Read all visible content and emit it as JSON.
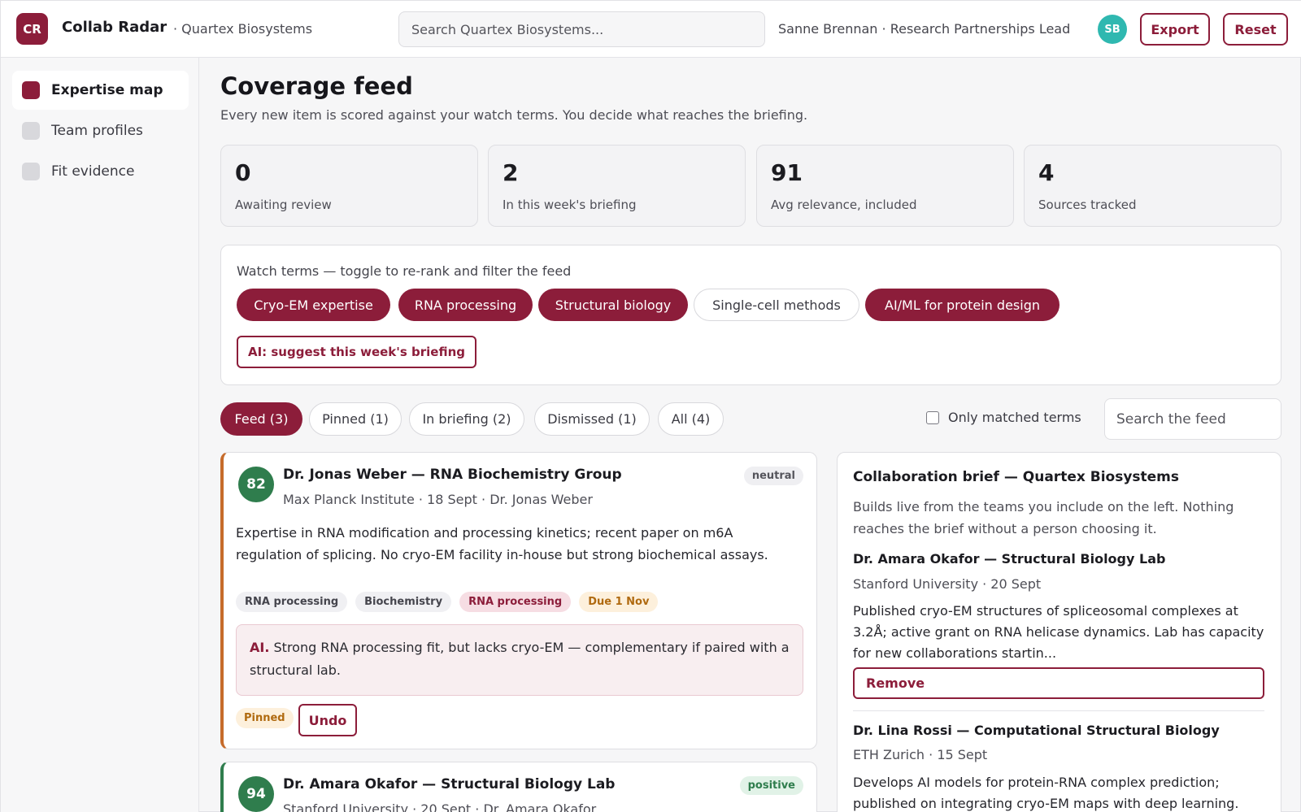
{
  "header": {
    "logo": "CR",
    "app_name": "Collab Radar",
    "org": "· Quartex Biosystems",
    "search_placeholder": "Search Quartex Biosystems...",
    "user": "Sanne Brennan · Research Partnerships Lead",
    "avatar": "SB",
    "export_label": "Export",
    "reset_label": "Reset"
  },
  "sidebar": {
    "items": [
      {
        "label": "Expertise map",
        "active": true
      },
      {
        "label": "Team profiles",
        "active": false
      },
      {
        "label": "Fit evidence",
        "active": false
      }
    ]
  },
  "main": {
    "title": "Coverage feed",
    "subtitle": "Every new item is scored against your watch terms. You decide what reaches the briefing."
  },
  "stats": [
    {
      "value": "0",
      "label": "Awaiting review"
    },
    {
      "value": "2",
      "label": "In this week's briefing"
    },
    {
      "value": "91",
      "label": "Avg relevance, included"
    },
    {
      "value": "4",
      "label": "Sources tracked"
    }
  ],
  "watch": {
    "title": "Watch terms — toggle to re-rank and filter the feed",
    "terms": [
      {
        "label": "Cryo-EM expertise",
        "on": true
      },
      {
        "label": "RNA processing",
        "on": true
      },
      {
        "label": "Structural biology",
        "on": true
      },
      {
        "label": "Single-cell methods",
        "on": false
      },
      {
        "label": "AI/ML for protein design",
        "on": true
      }
    ],
    "ai_button": "AI: suggest this week's briefing"
  },
  "tabs": [
    {
      "label": "Feed (3)",
      "active": true
    },
    {
      "label": "Pinned (1)",
      "active": false
    },
    {
      "label": "In briefing (2)",
      "active": false
    },
    {
      "label": "Dismissed (1)",
      "active": false
    },
    {
      "label": "All (4)",
      "active": false
    }
  ],
  "filter": {
    "only_matched_label": "Only matched terms",
    "search_placeholder": "Search the feed"
  },
  "feed": [
    {
      "score": "82",
      "title": "Dr. Jonas Weber — RNA Biochemistry Group",
      "meta": "Max Planck Institute · 18 Sept · Dr. Jonas Weber",
      "sentiment": "neutral",
      "body": "Expertise in RNA modification and processing kinetics; recent paper on m6A regulation of splicing. No cryo-EM facility in-house but strong biochemical assays.",
      "tags": [
        "RNA processing",
        "Biochemistry",
        "RNA processing",
        "Due 1 Nov"
      ],
      "ai_prefix": "AI.",
      "ai_note": "Strong RNA processing fit, but lacks cryo-EM — complementary if paired with a structural lab.",
      "status": "Pinned",
      "undo_label": "Undo"
    },
    {
      "score": "94",
      "title": "Dr. Amara Okafor — Structural Biology Lab",
      "meta": "Stanford University · 20 Sept · Dr. Amara Okafor",
      "sentiment": "positive"
    }
  ],
  "brief": {
    "title": "Collaboration brief — Quartex Biosystems",
    "desc": "Builds live from the teams you include on the left. Nothing reaches the brief without a person choosing it.",
    "items": [
      {
        "name": "Dr. Amara Okafor — Structural Biology Lab",
        "meta": "Stanford University · 20 Sept",
        "body": "Published cryo-EM structures of spliceosomal complexes at 3.2Å; active grant on RNA helicase dynamics. Lab has capacity for new collaborations startin...",
        "remove_label": "Remove"
      },
      {
        "name": "Dr. Lina Rossi — Computational Structural Biology",
        "meta": "ETH Zurich · 15 Sept",
        "body": "Develops AI models for protein-RNA complex prediction; published on integrating cryo-EM maps with deep learning."
      }
    ]
  },
  "colors": {
    "accent": "#8c1d3a",
    "score_green": "#2f7d4d",
    "pinned_orange": "#c66b2a",
    "avatar_teal": "#2fb8b0"
  }
}
